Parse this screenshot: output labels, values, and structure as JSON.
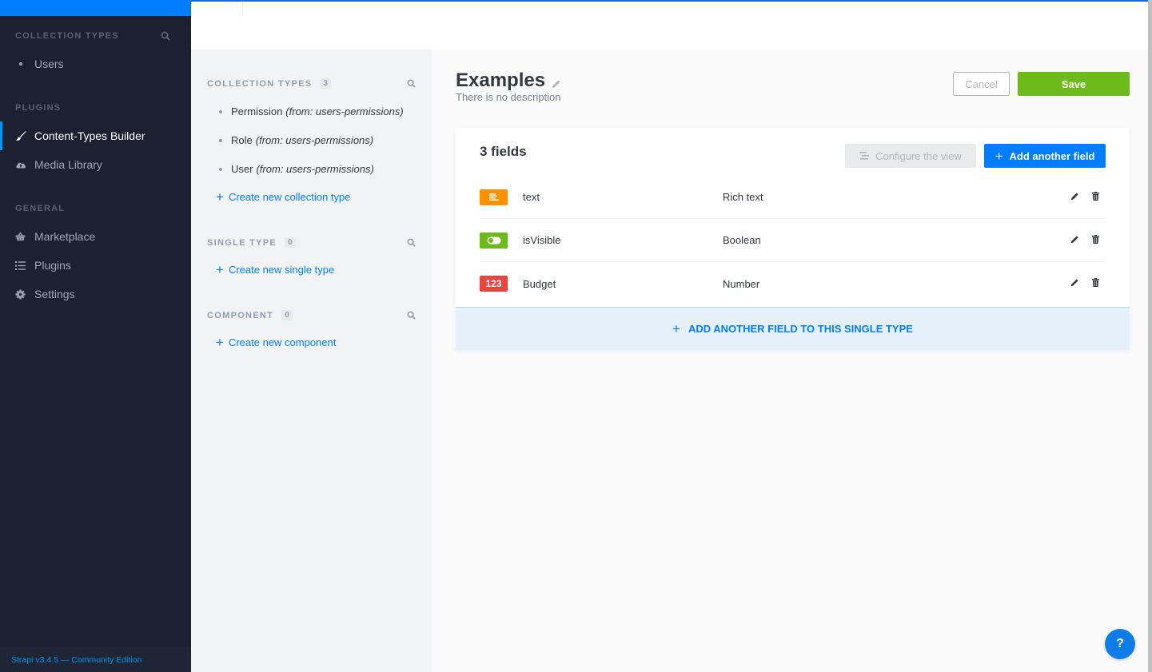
{
  "leftnav": {
    "collection_types_title": "Collection Types",
    "collection_items": [
      {
        "label": "Users"
      }
    ],
    "plugins_title": "Plugins",
    "plugin_items": [
      {
        "label": "Content-Types Builder",
        "icon": "paint-brush-icon",
        "active": true
      },
      {
        "label": "Media Library",
        "icon": "cloud-upload-icon",
        "active": false
      }
    ],
    "general_title": "General",
    "general_items": [
      {
        "label": "Marketplace",
        "icon": "shopping-basket-icon"
      },
      {
        "label": "Plugins",
        "icon": "list-icon"
      },
      {
        "label": "Settings",
        "icon": "gear-icon"
      }
    ],
    "footer": "Strapi v3.4.5 — Community Edition"
  },
  "subnav": {
    "collection_types": {
      "title": "Collection Types",
      "count": "3",
      "items": [
        {
          "name": "Permission",
          "source": "(from: users-permissions)"
        },
        {
          "name": "Role",
          "source": "(from: users-permissions)"
        },
        {
          "name": "User",
          "source": "(from: users-permissions)"
        }
      ],
      "create_label": "Create new collection type"
    },
    "single_type": {
      "title": "Single Type",
      "count": "0",
      "create_label": "Create new single type"
    },
    "component": {
      "title": "Component",
      "count": "0",
      "create_label": "Create new component"
    }
  },
  "main": {
    "title": "Examples",
    "description": "There is no description",
    "cancel_label": "Cancel",
    "save_label": "Save",
    "fields_count_label": "3 fields",
    "configure_label": "Configure the view",
    "add_field_label": "Add another field",
    "fields": [
      {
        "name": "text",
        "type": "Rich text",
        "icon": "rich-text-icon",
        "icon_text": "",
        "color": "#ff9100"
      },
      {
        "name": "isVisible",
        "type": "Boolean",
        "icon": "toggle-icon",
        "icon_text": "",
        "color": "#6dbb1a"
      },
      {
        "name": "Budget",
        "type": "Number",
        "icon": "number-icon",
        "icon_text": "123",
        "color": "#e8453c"
      }
    ],
    "add_to_type_label": "ADD ANOTHER FIELD TO THIS SINGLE TYPE"
  },
  "help_label": "?",
  "colors": {
    "accent": "#007eff",
    "save": "#6dbb1a",
    "nav_bg": "#1b2130"
  }
}
